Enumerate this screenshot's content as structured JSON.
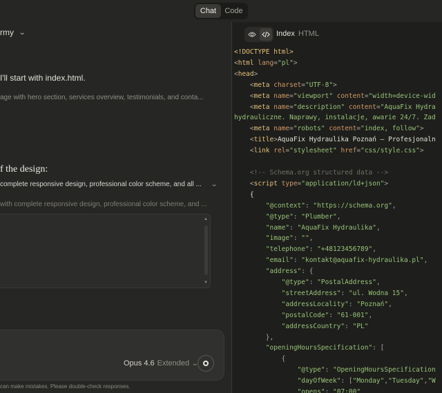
{
  "topbar": {
    "tabs": [
      "Chat",
      "Code"
    ],
    "active_tab": "Chat"
  },
  "chat": {
    "model_selector": "rmy",
    "line_start": "I'll start with index.html.",
    "line_sub": "age with hero section, services overview, testimonials, and conta...",
    "heading": "f the design:",
    "collapsed_summary": "complete responsive design, professional color scheme, and all ...",
    "muted_summary": "with complete responsive design, professional color scheme, and ...",
    "composer": {
      "model": "Opus 4.6",
      "mode": "Extended"
    },
    "disclaimer": "can make mistakes. Please double-check responses."
  },
  "code_panel": {
    "file_name": "Index",
    "file_type": "HTML",
    "lines": [
      [
        [
          "<!DOCTYPE html>",
          "c-t"
        ]
      ],
      [
        [
          "<",
          "c-p"
        ],
        [
          "html",
          "c-t"
        ],
        [
          " lang",
          "c-a"
        ],
        [
          "=",
          "c-p"
        ],
        [
          "\"pl\"",
          "c-s"
        ],
        [
          ">",
          "c-p"
        ]
      ],
      [
        [
          "<",
          "c-p"
        ],
        [
          "head",
          "c-t"
        ],
        [
          ">",
          "c-p"
        ]
      ],
      [
        [
          "    <",
          "c-p"
        ],
        [
          "meta",
          "c-t"
        ],
        [
          " charset",
          "c-a"
        ],
        [
          "=",
          "c-p"
        ],
        [
          "\"UTF-8\"",
          "c-s"
        ],
        [
          ">",
          "c-p"
        ]
      ],
      [
        [
          "    <",
          "c-p"
        ],
        [
          "meta",
          "c-t"
        ],
        [
          " name",
          "c-a"
        ],
        [
          "=",
          "c-p"
        ],
        [
          "\"viewport\"",
          "c-s"
        ],
        [
          " content",
          "c-a"
        ],
        [
          "=",
          "c-p"
        ],
        [
          "\"width=device-wid",
          "c-s"
        ]
      ],
      [
        [
          "    <",
          "c-p"
        ],
        [
          "meta",
          "c-t"
        ],
        [
          " name",
          "c-a"
        ],
        [
          "=",
          "c-p"
        ],
        [
          "\"description\"",
          "c-s"
        ],
        [
          " content",
          "c-a"
        ],
        [
          "=",
          "c-p"
        ],
        [
          "\"AquaFix Hydra",
          "c-s"
        ]
      ],
      [
        [
          "hydrauliczne. Naprawy, instalacje, awarie 24/7. Zad",
          "c-s"
        ]
      ],
      [
        [
          "    <",
          "c-p"
        ],
        [
          "meta",
          "c-t"
        ],
        [
          " name",
          "c-a"
        ],
        [
          "=",
          "c-p"
        ],
        [
          "\"robots\"",
          "c-s"
        ],
        [
          " content",
          "c-a"
        ],
        [
          "=",
          "c-p"
        ],
        [
          "\"index, follow\"",
          "c-s"
        ],
        [
          ">",
          "c-p"
        ]
      ],
      [
        [
          "    <",
          "c-p"
        ],
        [
          "title",
          "c-t"
        ],
        [
          ">",
          "c-p"
        ],
        [
          "AquaFix Hydraulika Poznań — Profesjonaln",
          "c-x"
        ]
      ],
      [
        [
          "    <",
          "c-p"
        ],
        [
          "link",
          "c-t"
        ],
        [
          " rel",
          "c-a"
        ],
        [
          "=",
          "c-p"
        ],
        [
          "\"stylesheet\"",
          "c-s"
        ],
        [
          " href",
          "c-a"
        ],
        [
          "=",
          "c-p"
        ],
        [
          "\"css/style.css\"",
          "c-s"
        ],
        [
          ">",
          "c-p"
        ]
      ],
      [
        [
          "",
          "c-x"
        ]
      ],
      [
        [
          "    <!-- Schema.org structured data -->",
          "c-c"
        ]
      ],
      [
        [
          "    <",
          "c-p"
        ],
        [
          "script",
          "c-t"
        ],
        [
          " type",
          "c-a"
        ],
        [
          "=",
          "c-p"
        ],
        [
          "\"application/ld+json\"",
          "c-s"
        ],
        [
          ">",
          "c-p"
        ]
      ],
      [
        [
          "    {",
          "c-x"
        ]
      ],
      [
        [
          "        ",
          "c-x"
        ],
        [
          "\"@context\"",
          "c-s"
        ],
        [
          ": ",
          "c-p"
        ],
        [
          "\"https://schema.org\"",
          "c-s"
        ],
        [
          ",",
          "c-p"
        ]
      ],
      [
        [
          "        ",
          "c-x"
        ],
        [
          "\"@type\"",
          "c-s"
        ],
        [
          ": ",
          "c-p"
        ],
        [
          "\"Plumber\"",
          "c-s"
        ],
        [
          ",",
          "c-p"
        ]
      ],
      [
        [
          "        ",
          "c-x"
        ],
        [
          "\"name\"",
          "c-s"
        ],
        [
          ": ",
          "c-p"
        ],
        [
          "\"AquaFix Hydraulika\"",
          "c-s"
        ],
        [
          ",",
          "c-p"
        ]
      ],
      [
        [
          "        ",
          "c-x"
        ],
        [
          "\"image\"",
          "c-s"
        ],
        [
          ": ",
          "c-p"
        ],
        [
          "\"\"",
          "c-s"
        ],
        [
          ",",
          "c-p"
        ]
      ],
      [
        [
          "        ",
          "c-x"
        ],
        [
          "\"telephone\"",
          "c-s"
        ],
        [
          ": ",
          "c-p"
        ],
        [
          "\"+48123456789\"",
          "c-s"
        ],
        [
          ",",
          "c-p"
        ]
      ],
      [
        [
          "        ",
          "c-x"
        ],
        [
          "\"email\"",
          "c-s"
        ],
        [
          ": ",
          "c-p"
        ],
        [
          "\"kontakt@aquafix-hydraulika.pl\"",
          "c-s"
        ],
        [
          ",",
          "c-p"
        ]
      ],
      [
        [
          "        ",
          "c-x"
        ],
        [
          "\"address\"",
          "c-s"
        ],
        [
          ": {",
          "c-p"
        ]
      ],
      [
        [
          "            ",
          "c-x"
        ],
        [
          "\"@type\"",
          "c-s"
        ],
        [
          ": ",
          "c-p"
        ],
        [
          "\"PostalAddress\"",
          "c-s"
        ],
        [
          ",",
          "c-p"
        ]
      ],
      [
        [
          "            ",
          "c-x"
        ],
        [
          "\"streetAddress\"",
          "c-s"
        ],
        [
          ": ",
          "c-p"
        ],
        [
          "\"ul. Wodna 15\"",
          "c-s"
        ],
        [
          ",",
          "c-p"
        ]
      ],
      [
        [
          "            ",
          "c-x"
        ],
        [
          "\"addressLocality\"",
          "c-s"
        ],
        [
          ": ",
          "c-p"
        ],
        [
          "\"Poznań\"",
          "c-s"
        ],
        [
          ",",
          "c-p"
        ]
      ],
      [
        [
          "            ",
          "c-x"
        ],
        [
          "\"postalCode\"",
          "c-s"
        ],
        [
          ": ",
          "c-p"
        ],
        [
          "\"61-001\"",
          "c-s"
        ],
        [
          ",",
          "c-p"
        ]
      ],
      [
        [
          "            ",
          "c-x"
        ],
        [
          "\"addressCountry\"",
          "c-s"
        ],
        [
          ": ",
          "c-p"
        ],
        [
          "\"PL\"",
          "c-s"
        ]
      ],
      [
        [
          "        },",
          "c-p"
        ]
      ],
      [
        [
          "        ",
          "c-x"
        ],
        [
          "\"openingHoursSpecification\"",
          "c-s"
        ],
        [
          ": [",
          "c-p"
        ]
      ],
      [
        [
          "            {",
          "c-p"
        ]
      ],
      [
        [
          "                ",
          "c-x"
        ],
        [
          "\"@type\"",
          "c-s"
        ],
        [
          ": ",
          "c-p"
        ],
        [
          "\"OpeningHoursSpecification",
          "c-s"
        ]
      ],
      [
        [
          "                ",
          "c-x"
        ],
        [
          "\"dayOfWeek\"",
          "c-s"
        ],
        [
          ": [",
          "c-p"
        ],
        [
          "\"Monday\"",
          "c-s"
        ],
        [
          ",",
          "c-p"
        ],
        [
          "\"Tuesday\"",
          "c-s"
        ],
        [
          ",",
          "c-p"
        ],
        [
          "\"W",
          "c-s"
        ]
      ],
      [
        [
          "                ",
          "c-x"
        ],
        [
          "\"opens\"",
          "c-s"
        ],
        [
          ": ",
          "c-p"
        ],
        [
          "\"07:00\"",
          "c-s"
        ]
      ]
    ]
  },
  "colors": {
    "accent": "#e5c07b",
    "string": "#98c379",
    "attribute": "#d19a66",
    "background": "#1e1e1c"
  }
}
